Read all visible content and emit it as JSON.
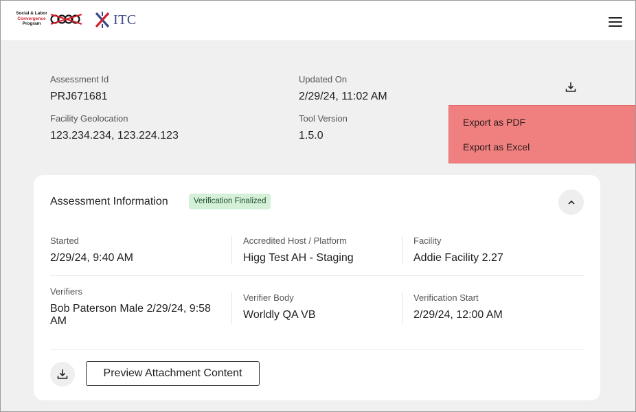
{
  "header": {
    "slcp_logo": {
      "line1": "Social & Labor",
      "line2": "Convergence",
      "line3": "Program",
      "icon": "slcp-logo"
    },
    "itc_logo": {
      "text": "ITC",
      "icon": "itc-logo-icon"
    },
    "menu_icon": "hamburger-menu-icon"
  },
  "summary": {
    "assessment_id": {
      "label": "Assessment Id",
      "value": "PRJ671681"
    },
    "updated_on": {
      "label": "Updated On",
      "value": "2/29/24, 11:02 AM"
    },
    "facility_geolocation": {
      "label": "Facility Geolocation",
      "value": "123.234.234, 123.224.123"
    },
    "tool_version": {
      "label": "Tool Version",
      "value": "1.5.0"
    },
    "download_icon": "download-icon"
  },
  "export_menu": {
    "items": [
      "Export as PDF",
      "Export as Excel"
    ],
    "background": "#f08080"
  },
  "assessment_info": {
    "title": "Assessment Information",
    "status_badge": "Verification Finalized",
    "badge_color": "#d4f0d8",
    "collapse_icon": "chevron-up-icon",
    "fields": {
      "started": {
        "label": "Started",
        "value": "2/29/24, 9:40 AM"
      },
      "accredited_host": {
        "label": "Accredited Host / Platform",
        "value": "Higg Test AH - Staging"
      },
      "facility": {
        "label": "Facility",
        "value": "Addie Facility 2.27"
      },
      "verifiers": {
        "label": "Verifiers",
        "value": "Bob Paterson  Male  2/29/24, 9:58 AM"
      },
      "verifier_body": {
        "label": "Verifier Body",
        "value": "Worldly QA VB"
      },
      "verification_start": {
        "label": "Verification Start",
        "value": "2/29/24, 12:00 AM"
      }
    },
    "attachment": {
      "download_icon": "download-icon",
      "preview_button": "Preview Attachment Content"
    }
  }
}
